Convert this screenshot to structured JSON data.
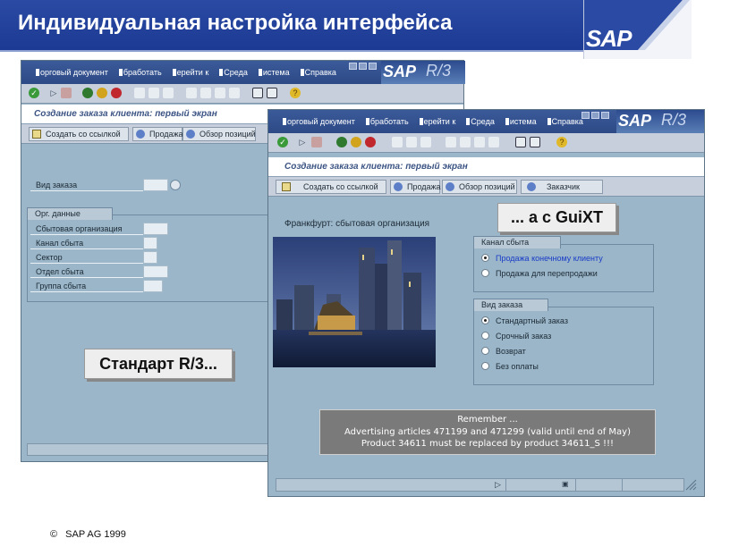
{
  "slide": {
    "title": "Индивидуальная настройка интерфейса",
    "logo": "SAP",
    "footer": "SAP AG 1999"
  },
  "sap_menu": [
    "орговый документ",
    "бработать",
    "ерейти к",
    "Среда",
    "истема",
    "Справка"
  ],
  "sap_brand": {
    "sap": "SAP",
    "r3": "R/3"
  },
  "left_window": {
    "form_title": "Создание заказа клиента: первый экран",
    "buttons": [
      "Создать со ссылкой",
      "Продажа",
      "Обзор позиций"
    ],
    "order_type_label": "Вид заказа",
    "org_group_title": "Орг. данные",
    "org_fields": [
      "Сбытовая организация",
      "Канал сбыта",
      "Сектор",
      "Отдел сбыта",
      "Группа сбыта"
    ],
    "callout": "Стандарт R/3..."
  },
  "right_window": {
    "form_title": "Создание заказа клиента: первый экран",
    "buttons": [
      "Создать со ссылкой",
      "Продажа",
      "Обзор позиций",
      "Заказчик"
    ],
    "org_label": "Франкфурт: сбытовая организация",
    "channel_group": {
      "title": "Канал сбыта",
      "options": [
        {
          "label": "Продажа конечному клиенту",
          "selected": true
        },
        {
          "label": "Продажа для перепродажи",
          "selected": false
        }
      ]
    },
    "order_type_group": {
      "title": "Вид заказа",
      "options": [
        {
          "label": "Стандартный заказ",
          "selected": true
        },
        {
          "label": "Срочный заказ",
          "selected": false
        },
        {
          "label": "Возврат",
          "selected": false
        },
        {
          "label": "Без оплаты",
          "selected": false
        }
      ]
    },
    "note": {
      "line1": "Remember ...",
      "line2": "Advertising articles 471199 and 471299 (valid until end of May)",
      "line3": "Product 34611 must be replaced by product 34611_S !!!"
    },
    "callout": "... а с GuiXT"
  },
  "colors": {
    "banner": "#1c3a93",
    "sap_window": "#9ab6c8",
    "menubar": "#2d4a86",
    "selected_link": "#1a3cc8"
  }
}
